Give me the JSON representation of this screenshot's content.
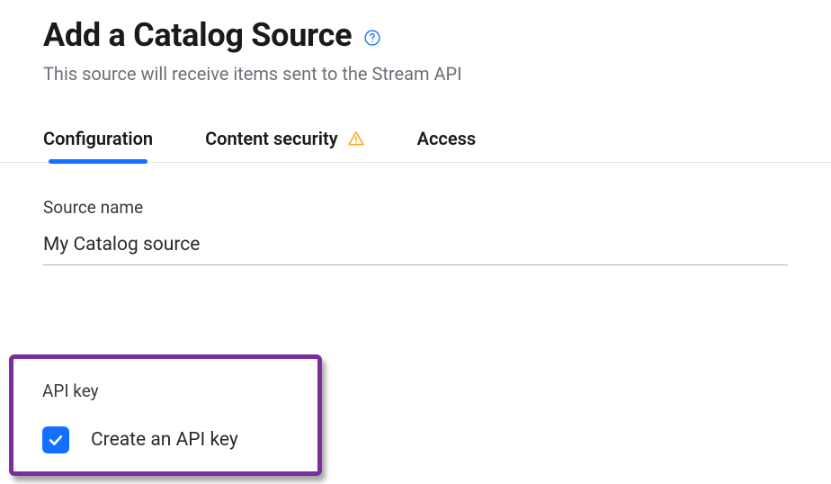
{
  "header": {
    "title": "Add a Catalog Source",
    "subtitle": "This source will receive items sent to the Stream API"
  },
  "tabs": {
    "configuration": "Configuration",
    "content_security": "Content security",
    "access": "Access"
  },
  "form": {
    "source_name_label": "Source name",
    "source_name_value": "My Catalog source",
    "api_key_label": "API key",
    "api_key_checkbox_label": "Create an API key",
    "api_key_checked": true
  },
  "colors": {
    "accent": "#1170ff",
    "highlight_border": "#7a2fa0",
    "warning": "#f5a623"
  }
}
